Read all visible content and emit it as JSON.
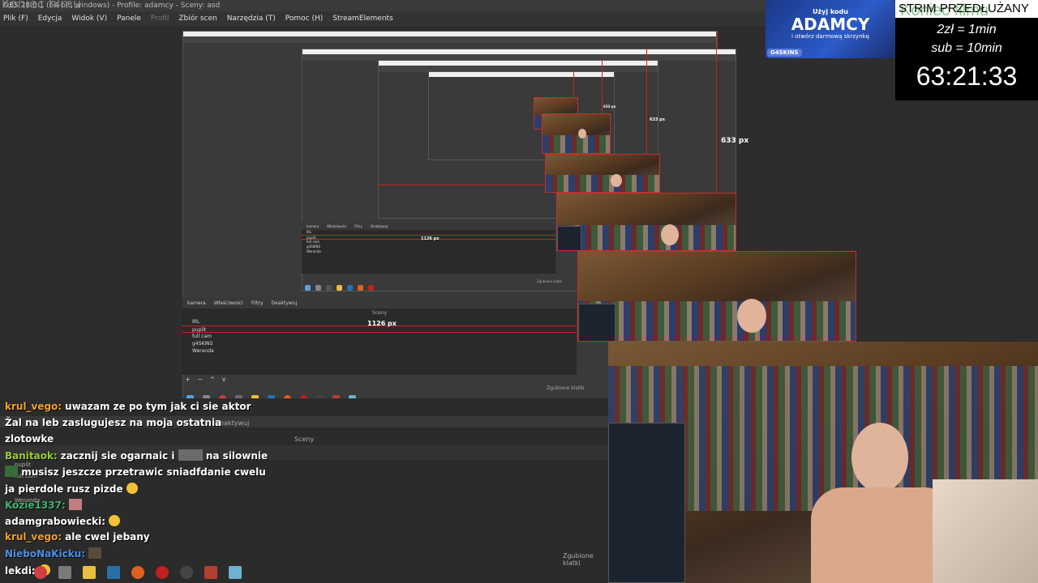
{
  "window": {
    "title": "OBS 28.0.1 (64-bit, windows) - Profile: adamcy - Sceny: asd",
    "ghost_overlay": "Koniec filmu"
  },
  "menu": [
    "Plik (F)",
    "Edycja",
    "Widok (V)",
    "Panele",
    "Profil",
    "Zbiór scen",
    "Narzędzia (T)",
    "Pomoc (H)",
    "StreamElements"
  ],
  "preview": {
    "label_large": "633 px",
    "label_mid": "633 px",
    "label_small": "633 px"
  },
  "scenes_dock": {
    "source_name": "kamera",
    "tabs": [
      "Właściwości",
      "Filtry",
      "Deaktywuj"
    ],
    "heading": "Sceny",
    "width_label": "1126 px",
    "items": [
      "IRL",
      "puplit",
      "full cam",
      "g4SKINS",
      "Weranda"
    ],
    "status": "Zgubione klatki"
  },
  "scenes_small": {
    "source_name": "kamera",
    "tabs": [
      "Właściwości",
      "Filtry",
      "Deaktywuj"
    ],
    "width_label": "1126 px",
    "items": [
      "IRL",
      "puplit",
      "full cam",
      "g4SKINS",
      "Weranda"
    ],
    "status": "Zgubione klatki"
  },
  "chat": {
    "bg_heading": "Sceny",
    "bg_items": [
      "puplit",
      "full cam",
      "Weranda"
    ],
    "bg_deactivate": "Deaktywuj",
    "bg_status": "Zgubione klatki",
    "messages": [
      {
        "user": "krul_vego:",
        "user_color": "#f0a030",
        "text": "uwazam ze po tym jak ci sie aktor"
      },
      {
        "user": "",
        "user_color": "#ffffff",
        "text": "Žal na leb zaslugujesz na moja ostatnia"
      },
      {
        "user": "",
        "user_color": "#ffffff",
        "text": "zlotowke"
      },
      {
        "user": "Banitaok:",
        "user_color": "#9acd32",
        "text": "zacznij sie ogarnaic i",
        "text2": "na silownie"
      },
      {
        "user": "",
        "user_color": "#ffffff",
        "text": "musisz jeszcze przetrawic sniadfdanie cwelu"
      },
      {
        "user": "",
        "user_color": "#ffffff",
        "text": "ja pierdole rusz pizde"
      },
      {
        "user": "Kozie1337:",
        "user_color": "#3cb371",
        "text": ""
      },
      {
        "user": "adamgrabowiecki:",
        "user_color": "#ffffff",
        "text": ""
      },
      {
        "user": "krul_vego:",
        "user_color": "#f0a030",
        "text": "ale cwel jebany"
      },
      {
        "user": "NieboNaKicku:",
        "user_color": "#4a90e2",
        "text": ""
      },
      {
        "user": "lekdi:",
        "user_color": "#ffffff",
        "text": ""
      }
    ]
  },
  "ad": {
    "line1": "Użyj kodu",
    "brand": "ADAMCY",
    "line2": "i otwórz darmową skrzynkę",
    "logo": "G4SKINS"
  },
  "subathon": {
    "title": "STRIM PRZEDŁUŻANY",
    "rate1": "2zł = 1min",
    "rate2": "sub = 10min",
    "timer": "63:21:33"
  }
}
